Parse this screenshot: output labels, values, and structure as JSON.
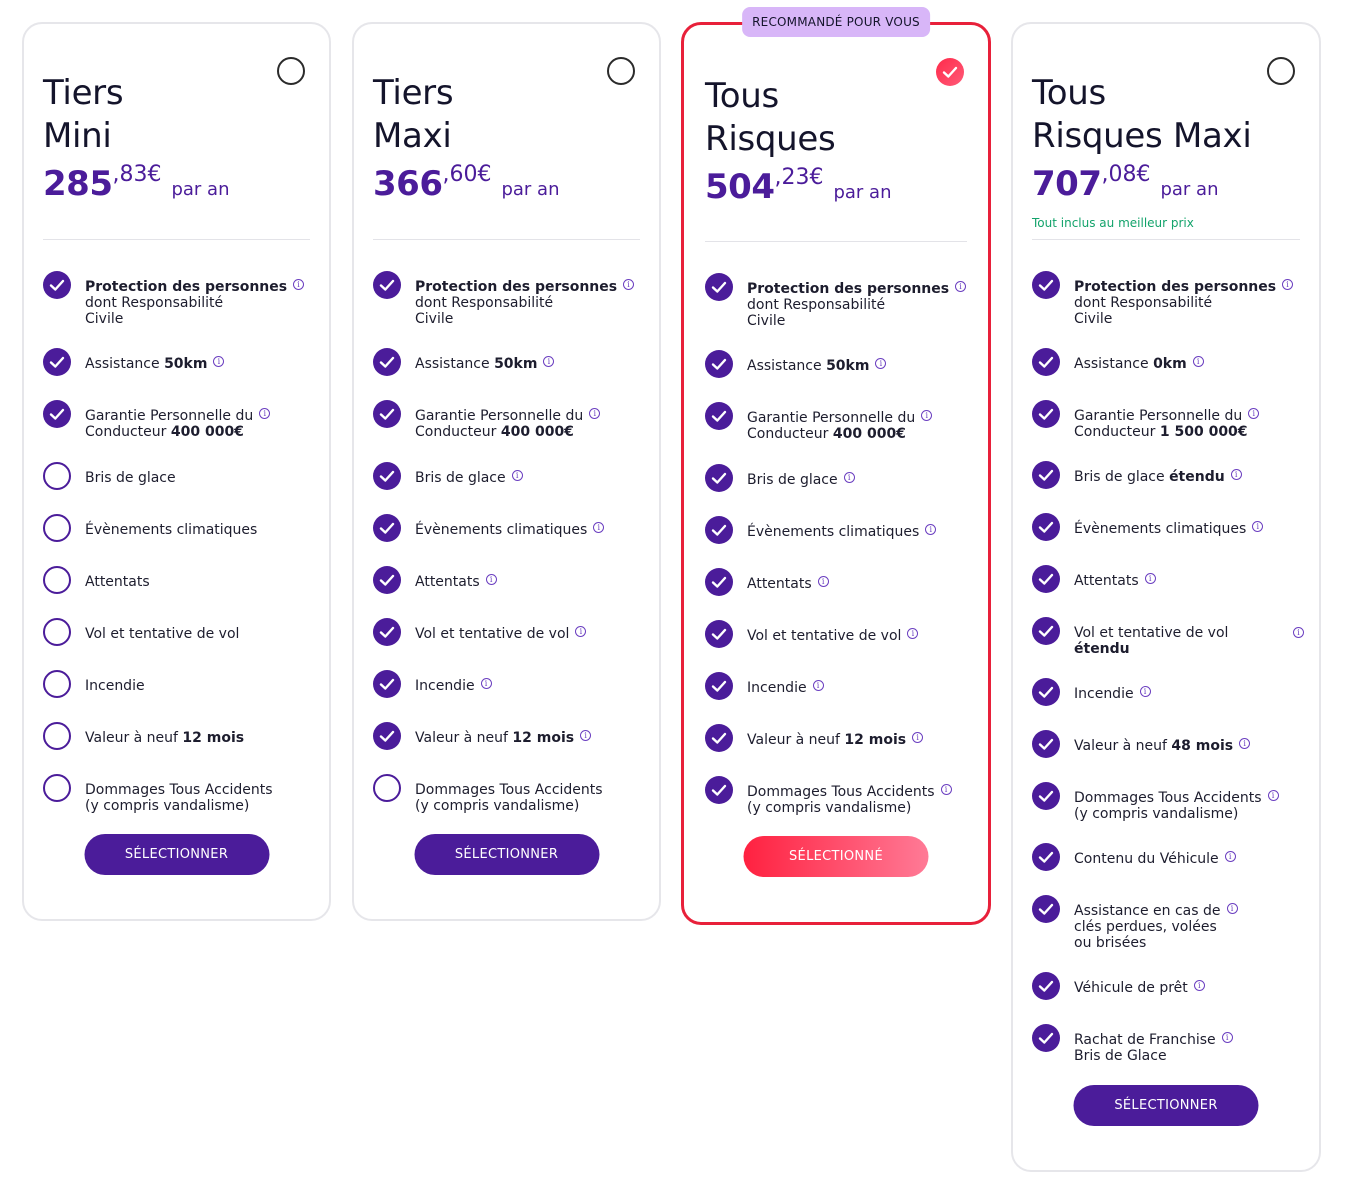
{
  "plans": [
    {
      "name_l1": "Tiers",
      "name_l2": "Mini",
      "price_int": "285",
      "price_dec": ",83€",
      "per": "par an",
      "button": "SÉLECTIONNER",
      "features": [
        {
          "l1": "Protection des personnes",
          "b1": true,
          "l2": "dont Responsabilité",
          "l3": "Civile",
          "included": true,
          "info": true
        },
        {
          "l1": "Assistance ",
          "l1b": "50km",
          "included": true,
          "info": true
        },
        {
          "l1": "Garantie Personnelle du",
          "l2": "Conducteur ",
          "l2b": "400 000€",
          "included": true,
          "info": true
        },
        {
          "l1": "Bris de glace",
          "included": false,
          "info": false
        },
        {
          "l1": "Évènements climatiques",
          "included": false,
          "info": false
        },
        {
          "l1": "Attentats",
          "included": false,
          "info": false
        },
        {
          "l1": "Vol et tentative de vol",
          "included": false,
          "info": false
        },
        {
          "l1": "Incendie",
          "included": false,
          "info": false
        },
        {
          "l1": "Valeur à neuf ",
          "l1b": "12 mois",
          "included": false,
          "info": false
        },
        {
          "l1": "Dommages Tous Accidents",
          "l2": "(y compris vandalisme)",
          "included": false,
          "info": false
        }
      ]
    },
    {
      "name_l1": "Tiers",
      "name_l2": "Maxi",
      "price_int": "366",
      "price_dec": ",60€",
      "per": "par an",
      "button": "SÉLECTIONNER",
      "features": [
        {
          "l1": "Protection des personnes",
          "b1": true,
          "l2": "dont Responsabilité",
          "l3": "Civile",
          "included": true,
          "info": true
        },
        {
          "l1": "Assistance ",
          "l1b": "50km",
          "included": true,
          "info": true
        },
        {
          "l1": "Garantie Personnelle du",
          "l2": "Conducteur ",
          "l2b": "400 000€",
          "included": true,
          "info": true
        },
        {
          "l1": "Bris de glace",
          "included": true,
          "info": true
        },
        {
          "l1": "Évènements climatiques",
          "included": true,
          "info": true
        },
        {
          "l1": "Attentats",
          "included": true,
          "info": true
        },
        {
          "l1": "Vol et tentative de vol",
          "included": true,
          "info": true
        },
        {
          "l1": "Incendie",
          "included": true,
          "info": true
        },
        {
          "l1": "Valeur à neuf ",
          "l1b": "12 mois",
          "included": true,
          "info": true
        },
        {
          "l1": "Dommages Tous Accidents",
          "l2": "(y compris vandalisme)",
          "included": false,
          "info": false
        }
      ]
    },
    {
      "name_l1": "Tous",
      "name_l2": "Risques",
      "price_int": "504",
      "price_dec": ",23€",
      "per": "par an",
      "badge": "RECOMMANDÉ POUR VOUS",
      "selected": true,
      "button": "SÉLECTIONNÉ",
      "features": [
        {
          "l1": "Protection des personnes",
          "b1": true,
          "l2": "dont Responsabilité",
          "l3": "Civile",
          "included": true,
          "info": true
        },
        {
          "l1": "Assistance ",
          "l1b": "50km",
          "included": true,
          "info": true
        },
        {
          "l1": "Garantie Personnelle du",
          "l2": "Conducteur ",
          "l2b": "400 000€",
          "included": true,
          "info": true
        },
        {
          "l1": "Bris de glace",
          "included": true,
          "info": true
        },
        {
          "l1": "Évènements climatiques",
          "included": true,
          "info": true
        },
        {
          "l1": "Attentats",
          "included": true,
          "info": true
        },
        {
          "l1": "Vol et tentative de vol",
          "included": true,
          "info": true
        },
        {
          "l1": "Incendie",
          "included": true,
          "info": true
        },
        {
          "l1": "Valeur à neuf ",
          "l1b": "12 mois",
          "included": true,
          "info": true
        },
        {
          "l1": "Dommages Tous Accidents",
          "l2": "(y compris vandalisme)",
          "included": true,
          "info": true
        }
      ]
    },
    {
      "name_l1": "Tous",
      "name_l2": "Risques Maxi",
      "price_int": "707",
      "price_dec": ",08€",
      "per": "par an",
      "tagline": "Tout inclus au meilleur prix",
      "button": "SÉLECTIONNER",
      "features": [
        {
          "l1": "Protection des personnes",
          "b1": true,
          "l2": "dont Responsabilité",
          "l3": "Civile",
          "included": true,
          "info": true
        },
        {
          "l1": "Assistance ",
          "l1b": "0km",
          "included": true,
          "info": true
        },
        {
          "l1": "Garantie Personnelle du",
          "l2": "Conducteur ",
          "l2b": "1 500 000€",
          "included": true,
          "info": true
        },
        {
          "l1": "Bris de glace ",
          "l1b": "étendu",
          "included": true,
          "info": true
        },
        {
          "l1": "Évènements climatiques",
          "included": true,
          "info": true
        },
        {
          "l1": "Attentats",
          "included": true,
          "info": true
        },
        {
          "l1": "Vol et tentative de vol",
          "l2b": "étendu",
          "included": true,
          "info": true,
          "info_far": true
        },
        {
          "l1": "Incendie",
          "included": true,
          "info": true
        },
        {
          "l1": "Valeur à neuf ",
          "l1b": "48 mois",
          "included": true,
          "info": true
        },
        {
          "l1": "Dommages Tous Accidents",
          "l2": "(y compris vandalisme)",
          "included": true,
          "info": true
        },
        {
          "l1": "Contenu du Véhicule",
          "included": true,
          "info": true
        },
        {
          "l1": "Assistance en cas de",
          "l2": "clés perdues, volées",
          "l3": "ou brisées",
          "included": true,
          "info": true
        },
        {
          "l1": "Véhicule de prêt",
          "included": true,
          "info": true
        },
        {
          "l1": "Rachat de Franchise",
          "l2": "Bris de Glace",
          "included": true,
          "info": true
        }
      ]
    }
  ]
}
